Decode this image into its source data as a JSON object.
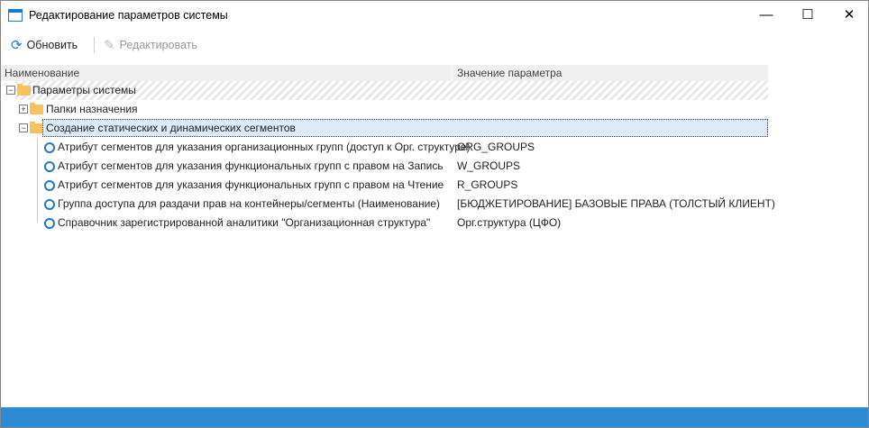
{
  "window": {
    "title": "Редактирование параметров системы",
    "minimize": "—",
    "maximize": "☐",
    "close": "✕"
  },
  "toolbar": {
    "refresh": "Обновить",
    "edit": "Редактировать"
  },
  "columns": {
    "name": "Наименование",
    "value": "Значение параметра"
  },
  "tree": {
    "root": "Параметры системы",
    "folder1": "Папки назначения",
    "folder2": "Создание статических и динамических сегментов",
    "params": [
      {
        "name": "Атрибут сегментов для указания организационных групп (доступ к Орг. структуре)",
        "value": "ORG_GROUPS"
      },
      {
        "name": "Атрибут сегментов для указания функциональных групп с правом на Запись",
        "value": "W_GROUPS"
      },
      {
        "name": "Атрибут сегментов для указания функциональных групп с правом на Чтение",
        "value": "R_GROUPS"
      },
      {
        "name": "Группа доступа для раздачи прав на контейнеры/сегменты (Наименование)",
        "value": "[БЮДЖЕТИРОВАНИЕ] БАЗОВЫЕ ПРАВА (ТОЛСТЫЙ КЛИЕНТ)"
      },
      {
        "name": "Справочник зарегистрированной аналитики \"Организационная структура\"",
        "value": "Орг.структура (ЦФО)"
      }
    ]
  },
  "colors": {
    "accent": "#1e78c8",
    "status_bar": "#2f8bd1",
    "selection": "#dcebf7",
    "folder": "#f7c25e"
  }
}
